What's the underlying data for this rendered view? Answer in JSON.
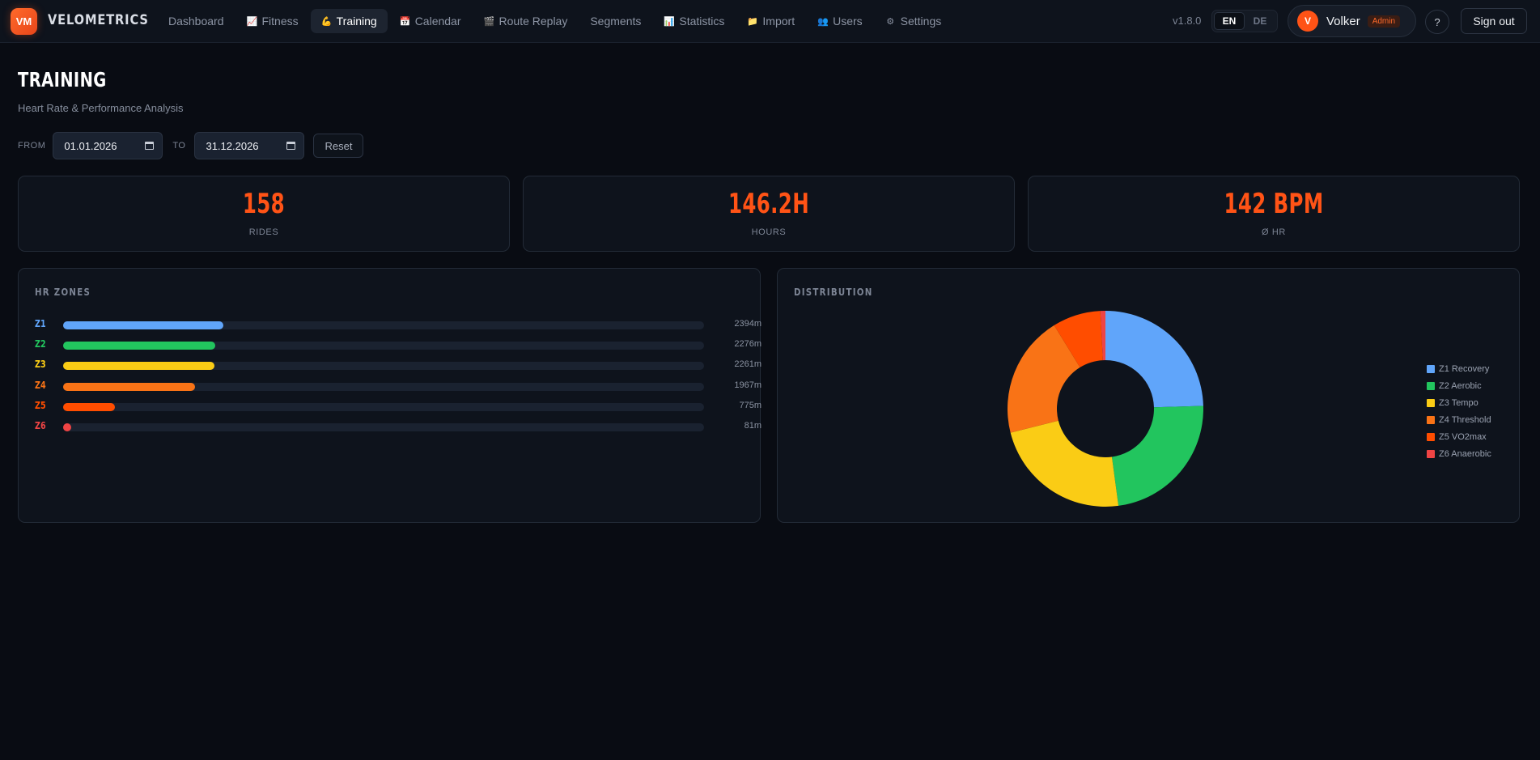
{
  "app": {
    "logo_initials": "VM",
    "brand": "VELOMETRICS",
    "version": "v1.8.0"
  },
  "nav": [
    {
      "id": "dashboard",
      "label": "Dashboard",
      "icon": "",
      "active": false
    },
    {
      "id": "fitness",
      "label": "Fitness",
      "icon": "📈",
      "active": false
    },
    {
      "id": "training",
      "label": "Training",
      "icon": "💪",
      "active": true
    },
    {
      "id": "calendar",
      "label": "Calendar",
      "icon": "📅",
      "active": false
    },
    {
      "id": "route-replay",
      "label": "Route Replay",
      "icon": "🎬",
      "active": false
    },
    {
      "id": "segments",
      "label": "Segments",
      "icon": "",
      "active": false
    },
    {
      "id": "statistics",
      "label": "Statistics",
      "icon": "📊",
      "active": false
    },
    {
      "id": "import",
      "label": "Import",
      "icon": "📁",
      "active": false
    },
    {
      "id": "users",
      "label": "Users",
      "icon": "👥",
      "active": false
    },
    {
      "id": "settings",
      "label": "Settings",
      "icon": "⚙",
      "active": false
    }
  ],
  "lang": {
    "en": "EN",
    "de": "DE",
    "active": "EN"
  },
  "user": {
    "initial": "V",
    "name": "Volker",
    "role": "Admin"
  },
  "help_label": "?",
  "signout_label": "Sign out",
  "page": {
    "title": "TRAINING",
    "subtitle": "Heart Rate & Performance Analysis"
  },
  "filters": {
    "from_label": "FROM",
    "from_value": "01.01.2026",
    "to_label": "TO",
    "to_value": "31.12.2026",
    "reset_label": "Reset"
  },
  "stats": [
    {
      "value": "158",
      "label": "RIDES"
    },
    {
      "value": "146.2H",
      "label": "HOURS"
    },
    {
      "value": "142 BPM",
      "label": "Ø HR"
    }
  ],
  "hr_zones": {
    "title": "HR ZONES",
    "zones": [
      {
        "label": "Z1",
        "value": "2394m",
        "minutes": 2394,
        "color": "#60a5fa"
      },
      {
        "label": "Z2",
        "value": "2276m",
        "minutes": 2276,
        "color": "#22c55e"
      },
      {
        "label": "Z3",
        "value": "2261m",
        "minutes": 2261,
        "color": "#facc15"
      },
      {
        "label": "Z4",
        "value": "1967m",
        "minutes": 1967,
        "color": "#f97316"
      },
      {
        "label": "Z5",
        "value": "775m",
        "minutes": 775,
        "color": "#ff4d00"
      },
      {
        "label": "Z6",
        "value": "81m",
        "minutes": 81,
        "color": "#ef4444"
      }
    ]
  },
  "distribution": {
    "title": "DISTRIBUTION",
    "legend": [
      {
        "label": "Z1 Recovery",
        "color": "#60a5fa"
      },
      {
        "label": "Z2 Aerobic",
        "color": "#22c55e"
      },
      {
        "label": "Z3 Tempo",
        "color": "#facc15"
      },
      {
        "label": "Z4 Threshold",
        "color": "#f97316"
      },
      {
        "label": "Z5 VO2max",
        "color": "#ff4d00"
      },
      {
        "label": "Z6 Anaerobic",
        "color": "#ef4444"
      }
    ]
  },
  "chart_data": {
    "type": "pie",
    "categories": [
      "Z1 Recovery",
      "Z2 Aerobic",
      "Z3 Tempo",
      "Z4 Threshold",
      "Z5 VO2max",
      "Z6 Anaerobic"
    ],
    "values": [
      2394,
      2276,
      2261,
      1967,
      775,
      81
    ],
    "donut": true,
    "legend": "right"
  }
}
